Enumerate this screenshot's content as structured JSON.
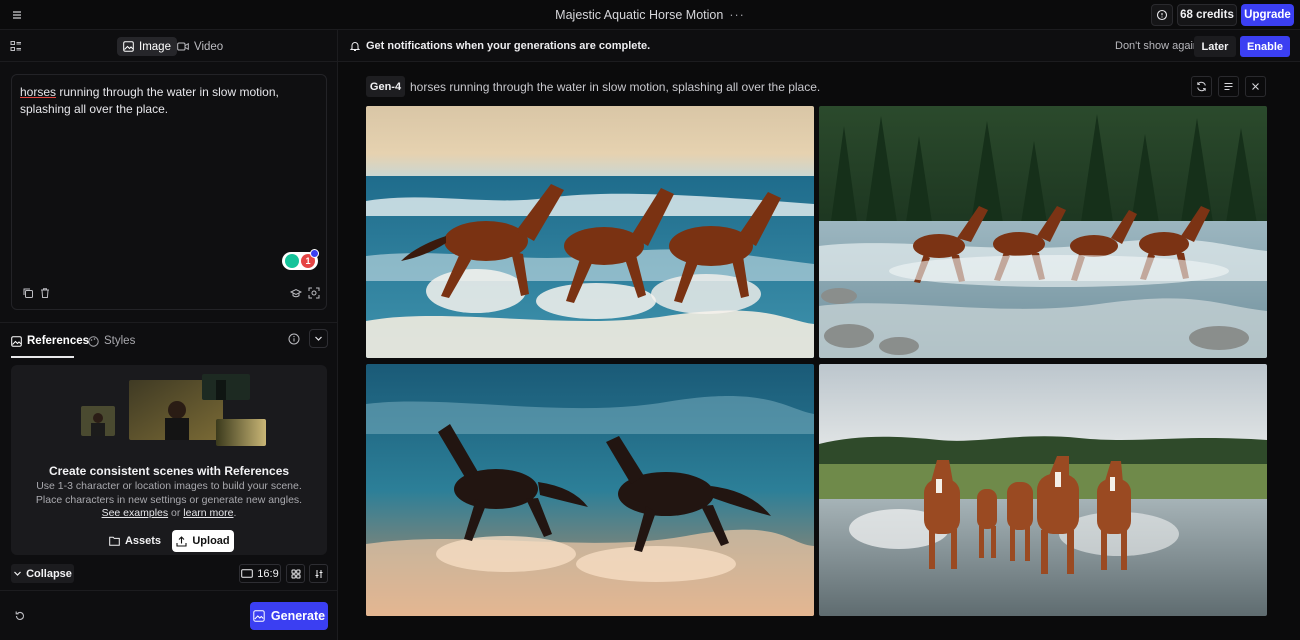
{
  "topbar": {
    "title": "Majestic Aquatic Horse Motion",
    "title_more": "···",
    "credits": "68 credits",
    "upgrade": "Upgrade"
  },
  "mode_tabs": [
    {
      "label": "Image",
      "icon": "image-icon",
      "active": true
    },
    {
      "label": "Video",
      "icon": "video-icon",
      "active": false
    }
  ],
  "prompt": {
    "first_word": "horses",
    "rest": " running through the water in slow motion, splashing all over the place."
  },
  "grammarly_count": "1",
  "references": {
    "tabs": [
      {
        "label": "References",
        "icon": "references-icon",
        "active": true
      },
      {
        "label": "Styles",
        "icon": "palette-icon",
        "active": false
      }
    ],
    "heading": "Create consistent scenes with References",
    "desc_line1": "Use 1-3 character or location images to build your scene.",
    "desc_line2": "Place characters in new settings or generate new angles.",
    "link1": "See examples",
    "link_join": " or ",
    "link2": "learn more",
    "link_end": ".",
    "assets_label": "Assets",
    "upload_label": "Upload"
  },
  "controls": {
    "collapse_label": "Collapse",
    "ratio_label": "16:9",
    "generate_label": "Generate"
  },
  "notification": {
    "message": "Get notifications when your generations are complete.",
    "dont_show": "Don't show again",
    "later": "Later",
    "enable": "Enable"
  },
  "gallery": {
    "model": "Gen-4",
    "prompt": "horses running through the water in slow motion, splashing all over the place."
  },
  "colors": {
    "accent": "#3b3ff2",
    "background": "#0b0b0c",
    "panel": "#0e0e10"
  }
}
